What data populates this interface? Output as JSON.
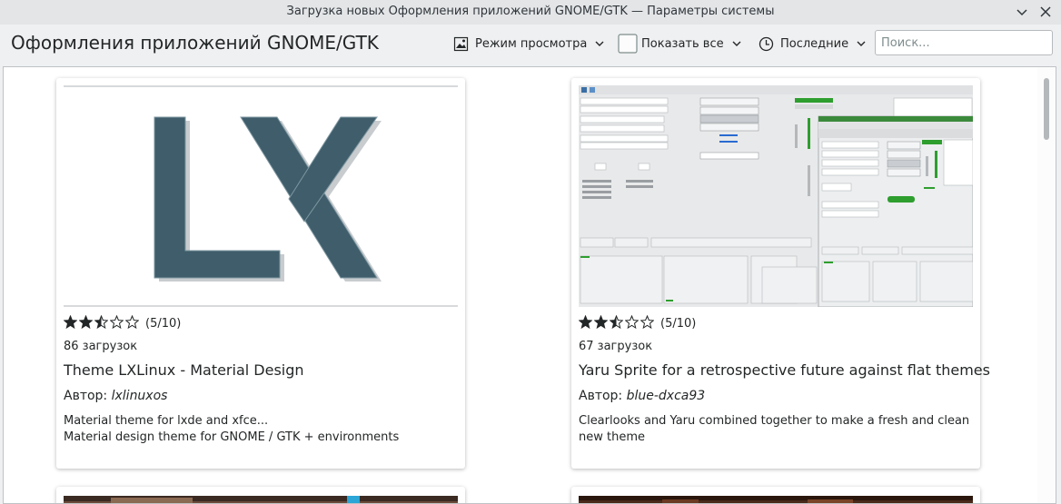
{
  "window": {
    "title": "Загрузка новых Оформления приложений GNOME/GTK — Параметры системы"
  },
  "header": {
    "page_title": "Оформления приложений GNOME/GTK",
    "view_mode_label": "Режим просмотра",
    "show_all_label": "Показать все",
    "sort_label": "Последние",
    "search_placeholder": "Поиск..."
  },
  "items": [
    {
      "rating": 2.5,
      "rating_text": "(5/10)",
      "downloads": "86 загрузок",
      "name": "Theme LXLinux - Material Design",
      "author_prefix": "Автор: ",
      "author": "lxlinuxos",
      "description": [
        "Material theme for lxde and xfce...",
        "Material design theme for GNOME / GTK + environments"
      ],
      "preview_text": "LX"
    },
    {
      "rating": 2.5,
      "rating_text": "(5/10)",
      "downloads": "67 загрузок",
      "name": "Yaru Sprite for a retrospective future against flat themes",
      "author_prefix": "Автор: ",
      "author": "blue-dxca93",
      "description": [
        "Clearlooks and Yaru combined together to make a fresh and clean new theme"
      ]
    }
  ],
  "colors": {
    "logo_fill": "#3f5d6a",
    "accent": "#3daee9",
    "star": "#232627"
  },
  "icons": [
    "chevron-down-icon",
    "close-icon",
    "view-mode-icon",
    "checkbox-icon",
    "clock-icon",
    "star-icon"
  ]
}
